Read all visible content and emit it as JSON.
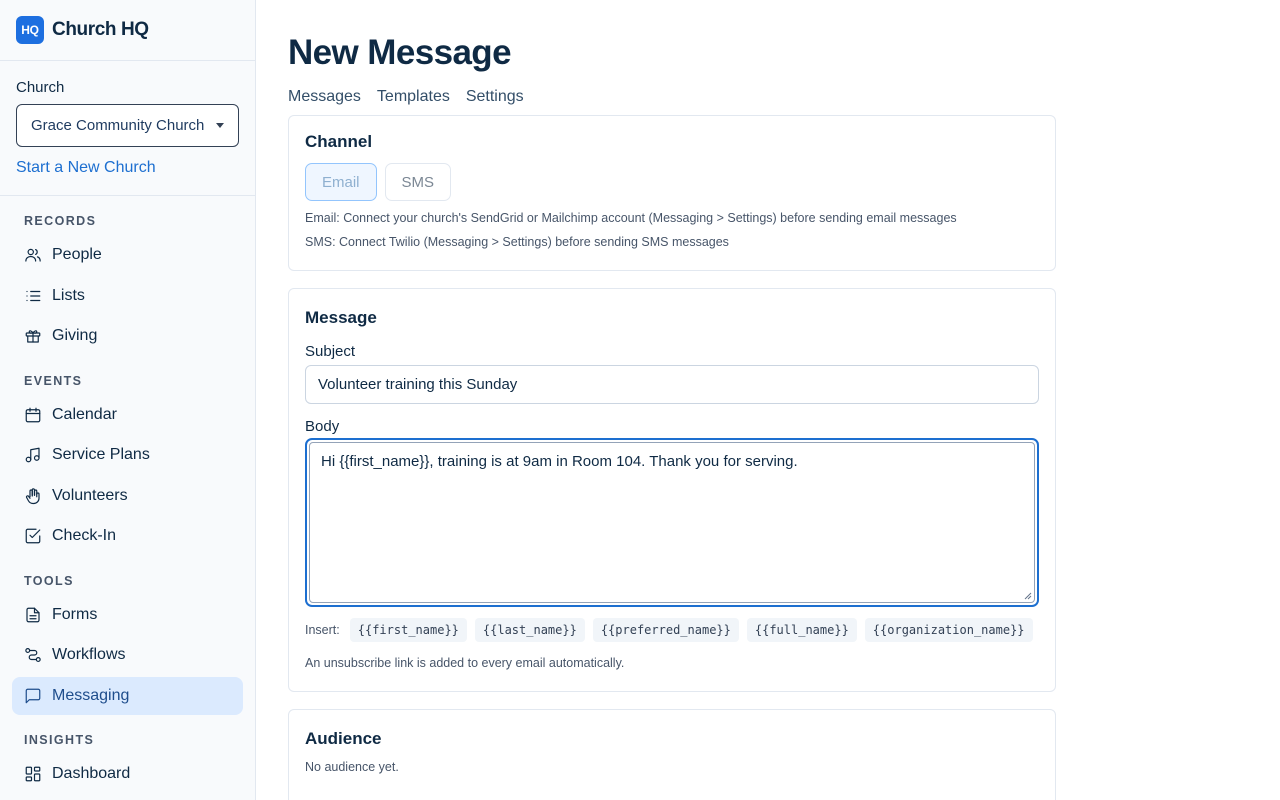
{
  "brand": {
    "logo": "HQ",
    "name": "Church HQ"
  },
  "church": {
    "label": "Church",
    "selected": "Grace Community Church",
    "new_church_link": "Start a New Church"
  },
  "nav": {
    "records": {
      "title": "RECORDS",
      "items": [
        {
          "label": "People",
          "icon": "people-icon"
        },
        {
          "label": "Lists",
          "icon": "list-icon"
        },
        {
          "label": "Giving",
          "icon": "gift-icon"
        }
      ]
    },
    "events": {
      "title": "EVENTS",
      "items": [
        {
          "label": "Calendar",
          "icon": "calendar-icon"
        },
        {
          "label": "Service Plans",
          "icon": "music-icon"
        },
        {
          "label": "Volunteers",
          "icon": "hand-icon"
        },
        {
          "label": "Check-In",
          "icon": "checkbox-icon"
        }
      ]
    },
    "tools": {
      "title": "TOOLS",
      "items": [
        {
          "label": "Forms",
          "icon": "document-icon"
        },
        {
          "label": "Workflows",
          "icon": "workflow-icon"
        },
        {
          "label": "Messaging",
          "icon": "chat-icon",
          "active": true
        }
      ]
    },
    "insights": {
      "title": "INSIGHTS",
      "items": [
        {
          "label": "Dashboard",
          "icon": "dashboard-icon"
        }
      ]
    }
  },
  "page": {
    "title": "New Message",
    "tabs": [
      "Messages",
      "Templates",
      "Settings"
    ]
  },
  "channel": {
    "title": "Channel",
    "options": [
      "Email",
      "SMS"
    ],
    "selected": "Email",
    "hint_email": "Email: Connect your church's SendGrid or Mailchimp account (Messaging > Settings) before sending email messages",
    "hint_sms": "SMS: Connect Twilio (Messaging > Settings) before sending SMS messages"
  },
  "message": {
    "title": "Message",
    "subject_label": "Subject",
    "subject_value": "Volunteer training this Sunday",
    "body_label": "Body",
    "body_value": "Hi {{first_name}}, training is at 9am in Room 104. Thank you for serving.",
    "insert_label": "Insert:",
    "insert_tokens": [
      "{{first_name}}",
      "{{last_name}}",
      "{{preferred_name}}",
      "{{full_name}}",
      "{{organization_name}}"
    ],
    "unsubscribe_note": "An unsubscribe link is added to every email automatically."
  },
  "audience": {
    "title": "Audience",
    "empty": "No audience yet."
  },
  "colors": {
    "accent": "#1d6fd0",
    "active_nav_bg": "#dbeafe",
    "logo_bg": "#1d6fe0"
  }
}
